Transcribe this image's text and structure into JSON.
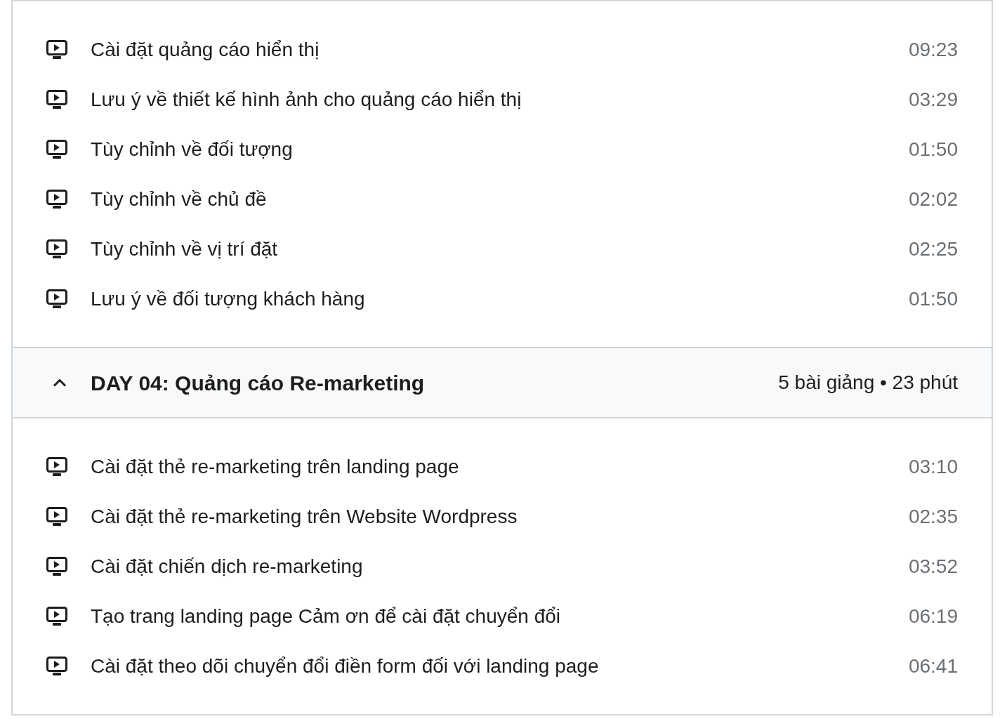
{
  "curriculum": {
    "continued_lectures": [
      {
        "title": "Cài đặt quảng cáo hiển thị",
        "duration": "09:23"
      },
      {
        "title": "Lưu ý về thiết kế hình ảnh cho quảng cáo hiển thị",
        "duration": "03:29"
      },
      {
        "title": "Tùy chỉnh về đối tượng",
        "duration": "01:50"
      },
      {
        "title": "Tùy chỉnh về chủ đề",
        "duration": "02:02"
      },
      {
        "title": "Tùy chỉnh về vị trí đặt",
        "duration": "02:25"
      },
      {
        "title": "Lưu ý về đối tượng khách hàng",
        "duration": "01:50"
      }
    ],
    "sections": [
      {
        "title": "DAY 04: Quảng cáo Re-marketing",
        "summary": "5 bài giảng • 23 phút",
        "expanded": true,
        "lectures": [
          {
            "title": "Cài đặt thẻ re-marketing trên landing page",
            "duration": "03:10"
          },
          {
            "title": "Cài đặt thẻ re-marketing trên Website Wordpress",
            "duration": "02:35"
          },
          {
            "title": "Cài đặt chiến dịch re-marketing",
            "duration": "03:52"
          },
          {
            "title": "Tạo trang landing page Cảm ơn để cài đặt chuyển đổi",
            "duration": "06:19"
          },
          {
            "title": "Cài đặt theo dõi chuyển đổi điền form đối với landing page",
            "duration": "06:41"
          }
        ]
      }
    ]
  }
}
